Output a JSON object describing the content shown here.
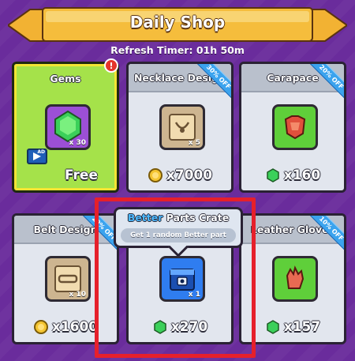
{
  "header": {
    "title": "Daily Shop",
    "refresh_timer": "Refresh Timer: 01h 50m"
  },
  "colors": {
    "background": "#6a2c9c",
    "banner": "#f2b233",
    "gems_card": "#a5e24a",
    "discount_ribbon": "#3ba3ee",
    "highlight": "#e6202b"
  },
  "shop_items": [
    {
      "name": "Gems",
      "quantity": "x 30",
      "price": "Free",
      "price_icon": "ad-video-icon",
      "item_icon": "gem-icon",
      "badge": "!"
    },
    {
      "name": "Necklace Design",
      "quantity": "x 5",
      "price": "x7000",
      "price_icon": "gold-coin-icon",
      "item_icon": "necklace-scroll-icon",
      "discount": "30% OFF"
    },
    {
      "name": "Carapace",
      "quantity": "",
      "price": "x160",
      "price_icon": "gem-icon",
      "item_icon": "carapace-armor-icon",
      "discount": "20% OFF"
    },
    {
      "name": "Belt Design",
      "quantity": "x 10",
      "price": "x1600",
      "price_icon": "gold-coin-icon",
      "item_icon": "belt-scroll-icon",
      "discount": "20% OFF"
    },
    {
      "name": "Better Parts Crate",
      "quantity": "x 1",
      "price": "x270",
      "price_icon": "gem-icon",
      "item_icon": "parts-crate-icon"
    },
    {
      "name": "Leather Gloves",
      "quantity": "",
      "price": "x157",
      "price_icon": "gem-icon",
      "item_icon": "leather-gloves-icon",
      "discount": "10% OFF"
    }
  ],
  "tooltip": {
    "tier": "Better",
    "title_rest": " Parts Crate",
    "description": "Get 1 random Better part"
  },
  "ad_label": "AD"
}
